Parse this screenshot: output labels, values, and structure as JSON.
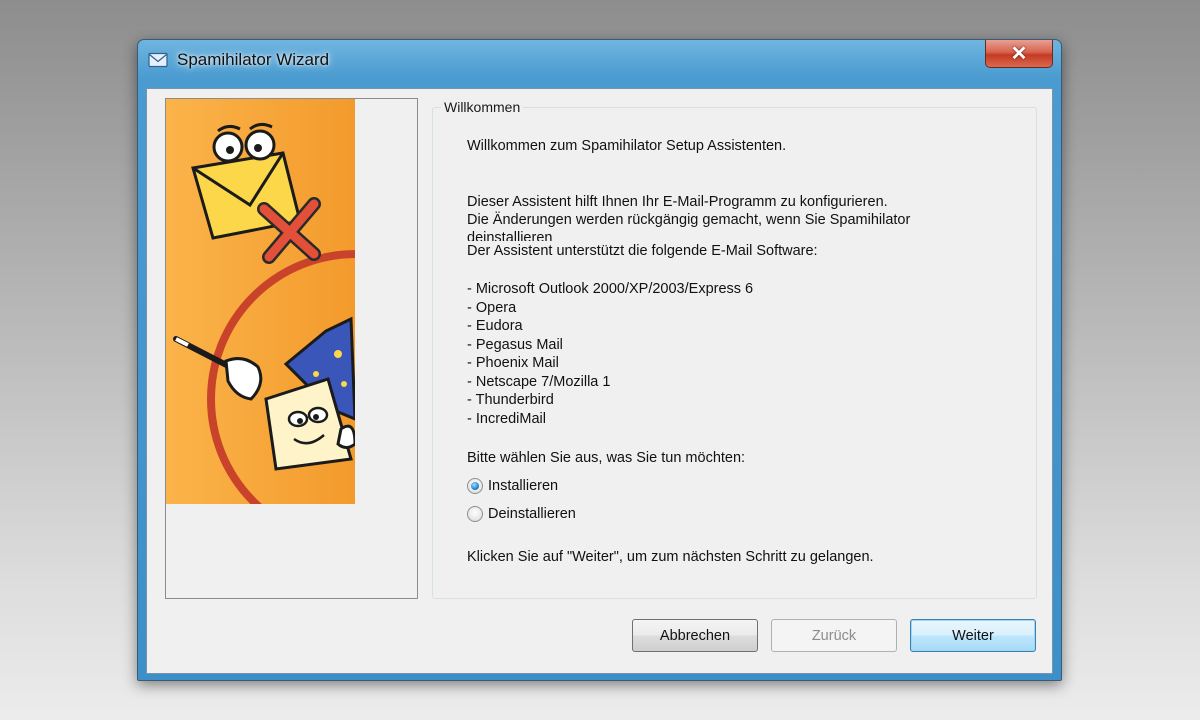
{
  "window": {
    "title": "Spamihilator Wizard",
    "close_glyph": "✕"
  },
  "group": {
    "legend": "Willkommen",
    "welcome": "Willkommen zum Spamihilator Setup Assistenten.",
    "desc_line1": "Dieser Assistent hilft Ihnen Ihr E-Mail-Programm zu konfigurieren.",
    "desc_line2": "Die Änderungen werden rückgängig gemacht, wenn Sie Spamihilator",
    "desc_line3": "deinstallieren",
    "supports": "Der Assistent unterstützt die folgende E-Mail Software:",
    "software": [
      "- Microsoft Outlook 2000/XP/2003/Express 6",
      "- Opera",
      "- Eudora",
      "- Pegasus Mail",
      "- Phoenix Mail",
      "- Netscape 7/Mozilla 1",
      "- Thunderbird",
      "- IncrediMail"
    ],
    "choose": "Bitte wählen Sie aus, was Sie tun möchten:",
    "options": [
      {
        "label": "Installieren",
        "checked": true
      },
      {
        "label": "Deinstallieren",
        "checked": false
      }
    ],
    "next_hint": "Klicken Sie auf \"Weiter\", um zum nächsten Schritt zu gelangen."
  },
  "buttons": {
    "cancel": "Abbrechen",
    "back": "Zurück",
    "next": "Weiter"
  },
  "colors": {
    "illustration_bg": "#f9a93a",
    "circle": "#c9432b",
    "envelope": "#fcd74a",
    "hat": "#3a56b8"
  },
  "icons": [
    "mail-icon",
    "close-icon",
    "radio-checked",
    "radio-unchecked"
  ]
}
